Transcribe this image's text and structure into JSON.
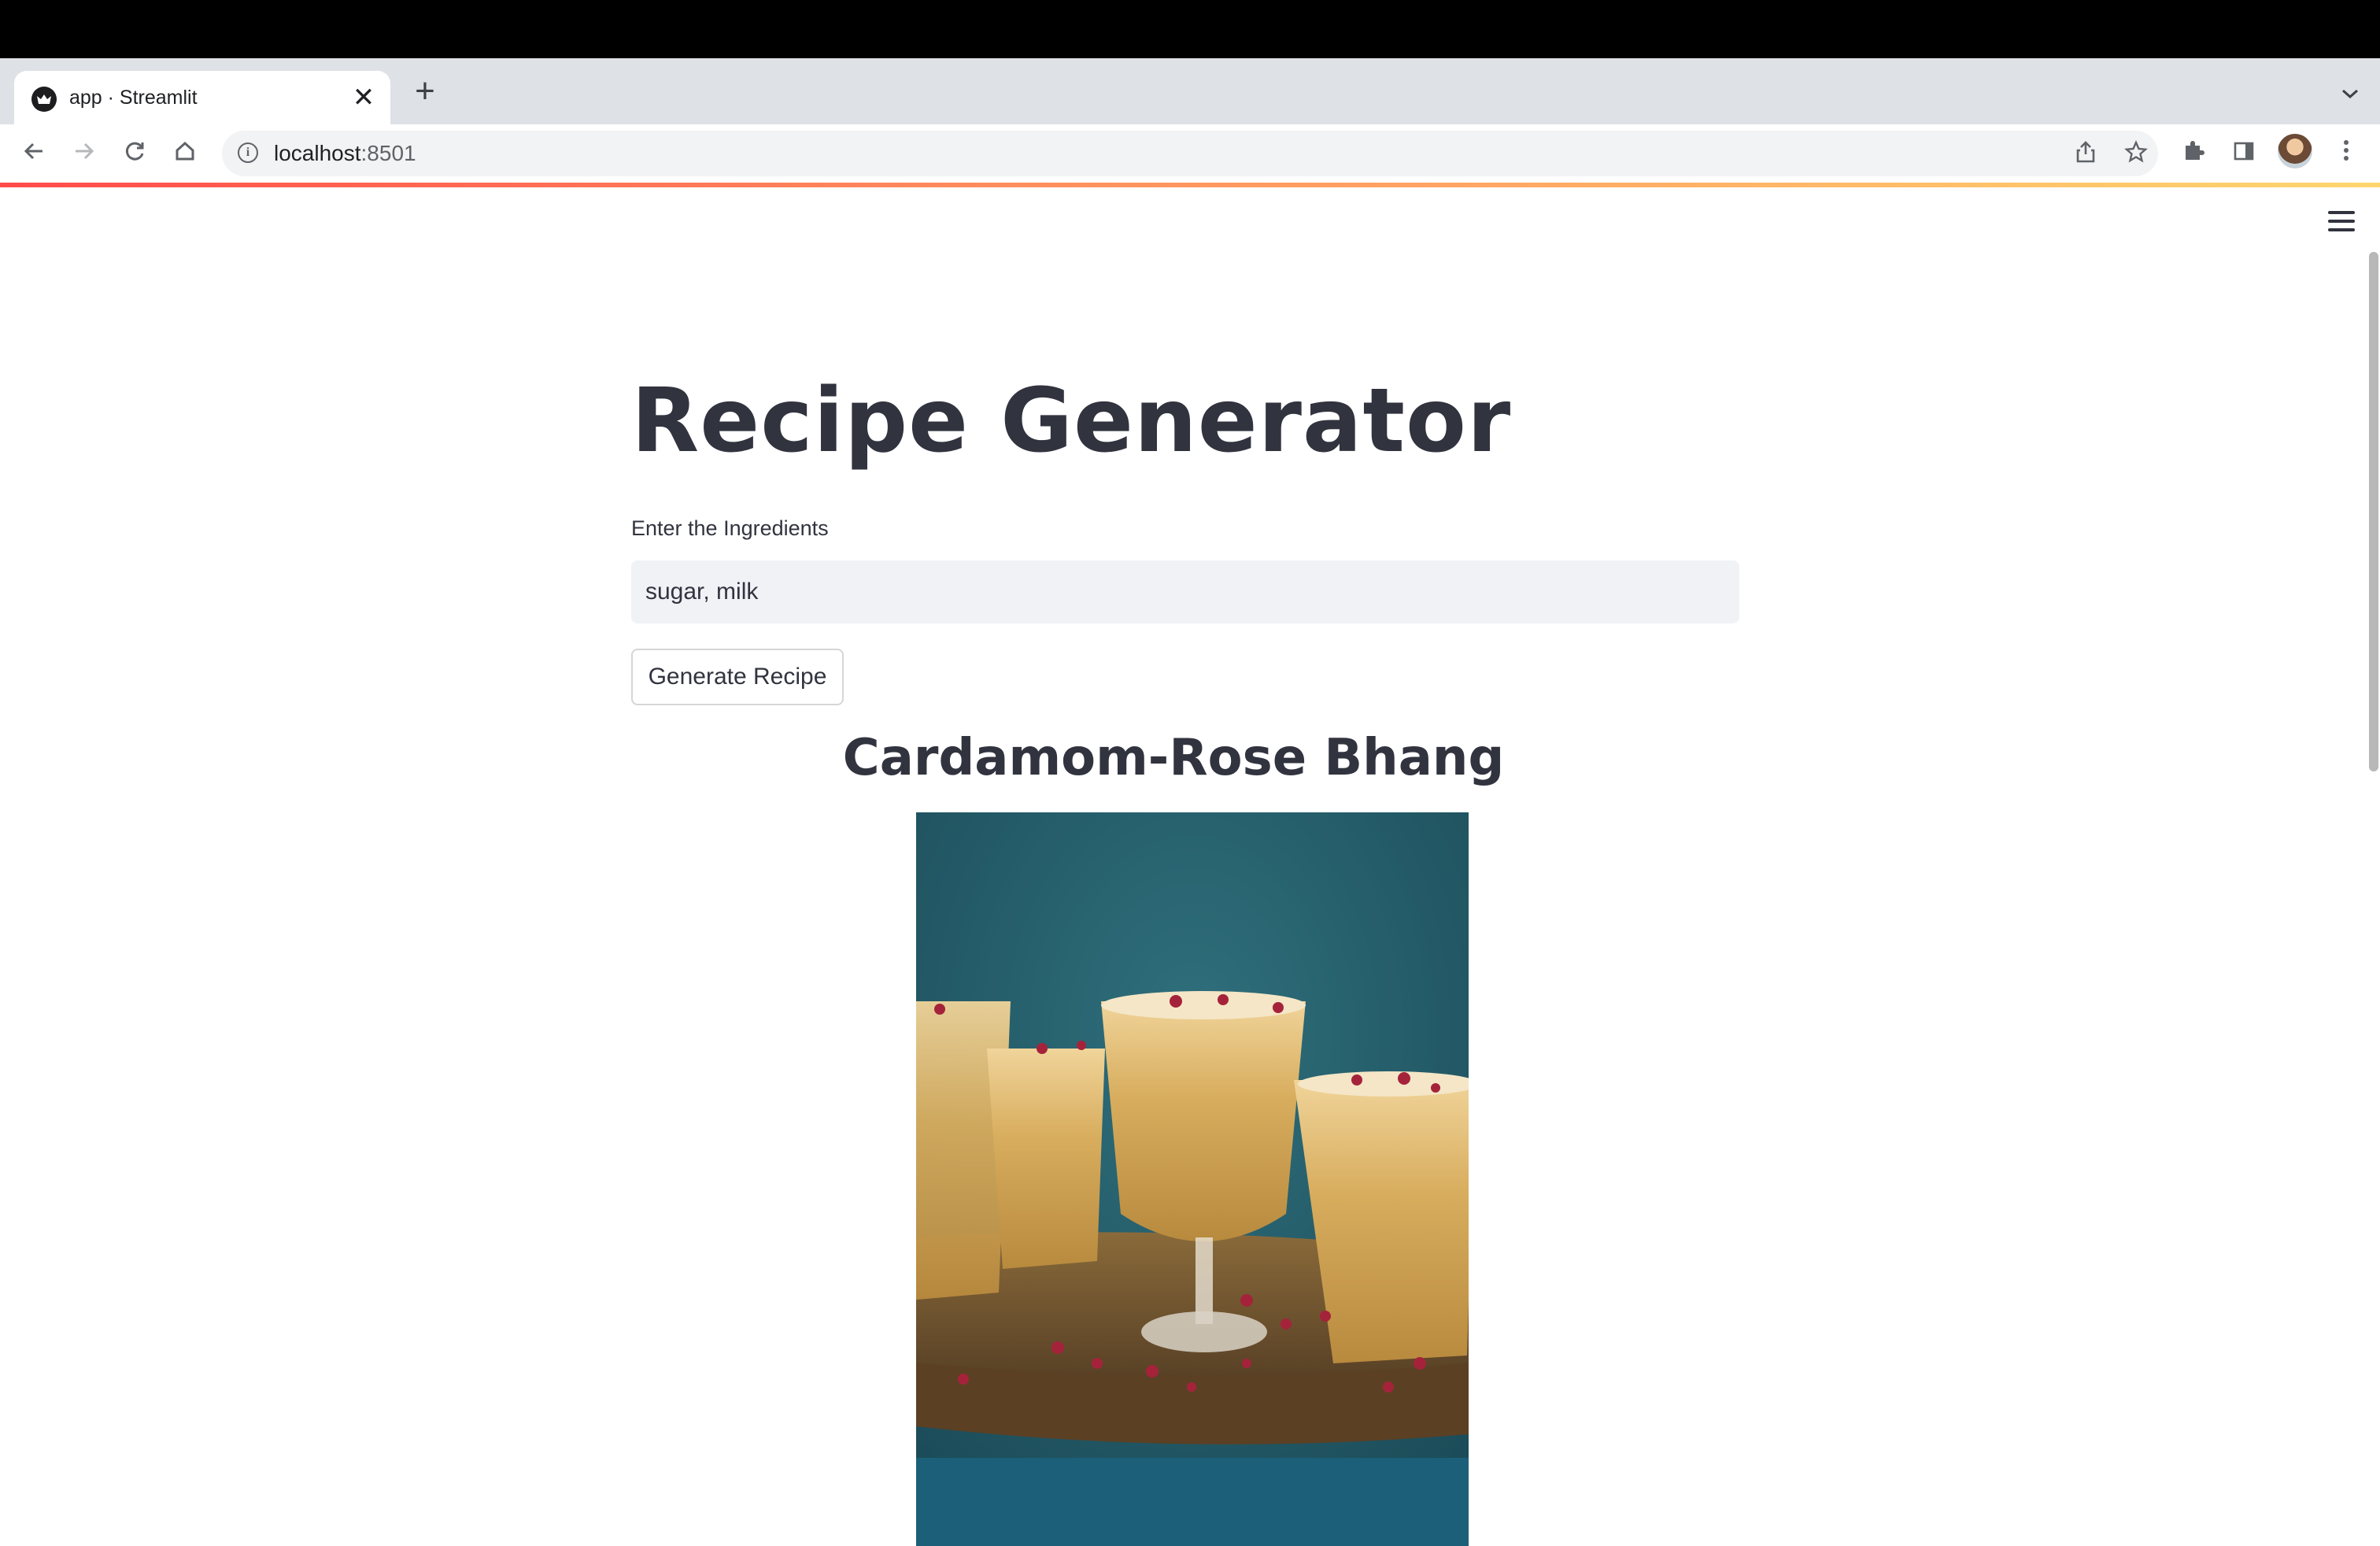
{
  "browser": {
    "tab": {
      "title": "app · Streamlit",
      "close_glyph": "✕"
    },
    "new_tab_glyph": "+",
    "tab_menu_glyph": "⌄",
    "url_host": "localhost",
    "url_port": ":8501",
    "icons": [
      "back-icon",
      "forward-icon",
      "reload-icon",
      "home-icon",
      "site-info-icon",
      "share-icon",
      "bookmark-star-icon",
      "extensions-icon",
      "side-panel-icon",
      "profile-avatar",
      "kebab-menu-icon"
    ]
  },
  "app": {
    "title": "Recipe Generator",
    "input_label": "Enter the Ingredients",
    "input_value": "sugar, milk",
    "button_label": "Generate Recipe",
    "recipe_title": "Cardamom-Rose Bhang"
  },
  "colors": {
    "text": "#31333f",
    "input_bg": "#f0f2f6",
    "accent_gradient_start": "#ff4b4b",
    "accent_gradient_end": "#ffd66e"
  }
}
